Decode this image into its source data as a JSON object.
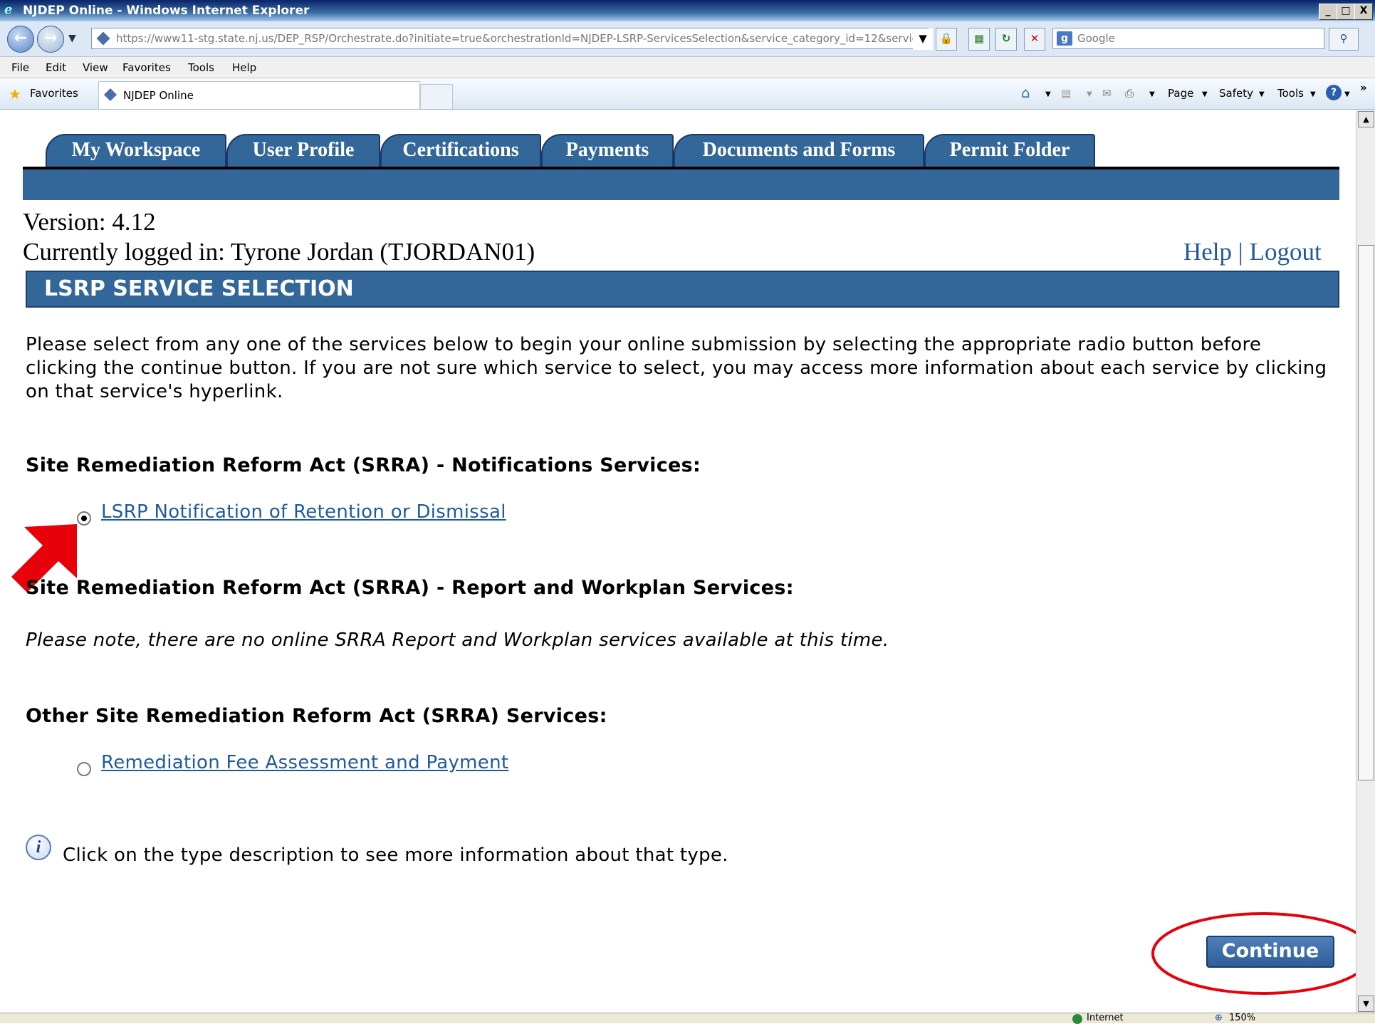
{
  "window": {
    "title": "NJDEP Online - Windows Internet Explorer",
    "controls": [
      "_",
      "□",
      "X"
    ]
  },
  "address": {
    "url": "https://www11-stg.state.nj.us/DEP_RSP/Orchestrate.do?initiate=true&orchestrationId=NJDEP-LSRP-ServicesSelection&service_category_id=12&service",
    "search_placeholder": "Google"
  },
  "menu": [
    "File",
    "Edit",
    "View",
    "Favorites",
    "Tools",
    "Help"
  ],
  "favorites": {
    "label": "Favorites",
    "tab_title": "NJDEP Online",
    "commands": [
      "Page",
      "Safety",
      "Tools"
    ]
  },
  "app": {
    "tabs": [
      "My Workspace",
      "User Profile",
      "Certifications",
      "Payments",
      "Documents and Forms",
      "Permit Folder"
    ],
    "version": "Version: 4.12",
    "logged_in": "Currently logged in: Tyrone Jordan (TJORDAN01)",
    "help_link": "Help",
    "separator": "|",
    "logout_link": "Logout",
    "section_title": "LSRP SERVICE SELECTION",
    "intro": "Please select from any one of the services below to begin your online submission by selecting the appropriate radio button before clicking the continue button. If you are not sure which service to select, you may access more information about each service by clicking on that service's hyperlink.",
    "groups": [
      {
        "heading": "Site Remediation Reform Act (SRRA) - Notifications Services:",
        "option": "LSRP Notification of Retention or Dismissal",
        "selected": true
      },
      {
        "heading": "Site Remediation Reform Act (SRRA) - Report and Workplan Services:",
        "note": "Please note, there are no online SRRA Report and Workplan services available at this time."
      },
      {
        "heading": "Other Site Remediation Reform Act (SRRA) Services:",
        "option": "Remediation Fee Assessment and Payment",
        "selected": false
      }
    ],
    "info_text": "Click on the type description to see more information about that type.",
    "continue_label": "Continue"
  },
  "status": {
    "zone": "Internet",
    "zoom": "150%"
  },
  "colors": {
    "accent": "#336699",
    "link": "#1f5a9e",
    "annotation": "#e8000b"
  }
}
